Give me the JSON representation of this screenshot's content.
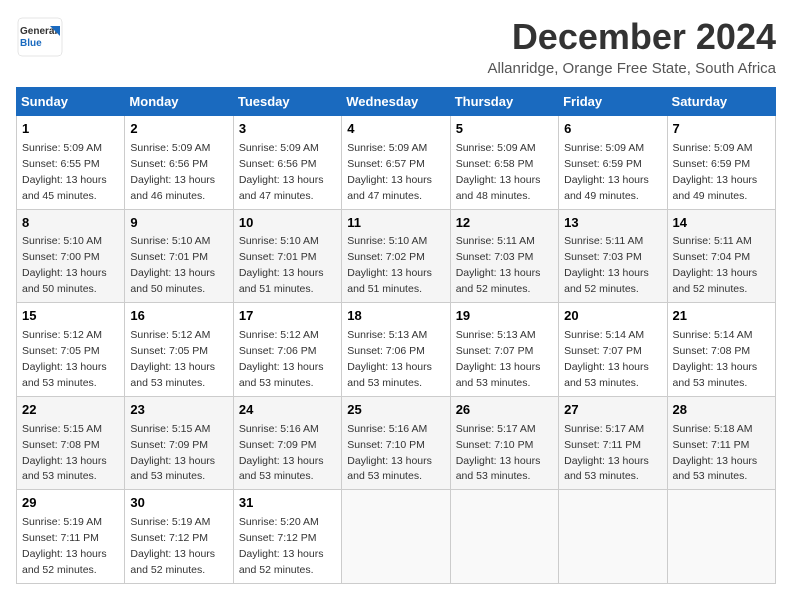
{
  "header": {
    "logo_general": "General",
    "logo_blue": "Blue",
    "month_year": "December 2024",
    "location": "Allanridge, Orange Free State, South Africa"
  },
  "weekdays": [
    "Sunday",
    "Monday",
    "Tuesday",
    "Wednesday",
    "Thursday",
    "Friday",
    "Saturday"
  ],
  "weeks": [
    [
      {
        "day": "1",
        "sunrise": "5:09 AM",
        "sunset": "6:55 PM",
        "daylight": "13 hours and 45 minutes."
      },
      {
        "day": "2",
        "sunrise": "5:09 AM",
        "sunset": "6:56 PM",
        "daylight": "13 hours and 46 minutes."
      },
      {
        "day": "3",
        "sunrise": "5:09 AM",
        "sunset": "6:56 PM",
        "daylight": "13 hours and 47 minutes."
      },
      {
        "day": "4",
        "sunrise": "5:09 AM",
        "sunset": "6:57 PM",
        "daylight": "13 hours and 47 minutes."
      },
      {
        "day": "5",
        "sunrise": "5:09 AM",
        "sunset": "6:58 PM",
        "daylight": "13 hours and 48 minutes."
      },
      {
        "day": "6",
        "sunrise": "5:09 AM",
        "sunset": "6:59 PM",
        "daylight": "13 hours and 49 minutes."
      },
      {
        "day": "7",
        "sunrise": "5:09 AM",
        "sunset": "6:59 PM",
        "daylight": "13 hours and 49 minutes."
      }
    ],
    [
      {
        "day": "8",
        "sunrise": "5:10 AM",
        "sunset": "7:00 PM",
        "daylight": "13 hours and 50 minutes."
      },
      {
        "day": "9",
        "sunrise": "5:10 AM",
        "sunset": "7:01 PM",
        "daylight": "13 hours and 50 minutes."
      },
      {
        "day": "10",
        "sunrise": "5:10 AM",
        "sunset": "7:01 PM",
        "daylight": "13 hours and 51 minutes."
      },
      {
        "day": "11",
        "sunrise": "5:10 AM",
        "sunset": "7:02 PM",
        "daylight": "13 hours and 51 minutes."
      },
      {
        "day": "12",
        "sunrise": "5:11 AM",
        "sunset": "7:03 PM",
        "daylight": "13 hours and 52 minutes."
      },
      {
        "day": "13",
        "sunrise": "5:11 AM",
        "sunset": "7:03 PM",
        "daylight": "13 hours and 52 minutes."
      },
      {
        "day": "14",
        "sunrise": "5:11 AM",
        "sunset": "7:04 PM",
        "daylight": "13 hours and 52 minutes."
      }
    ],
    [
      {
        "day": "15",
        "sunrise": "5:12 AM",
        "sunset": "7:05 PM",
        "daylight": "13 hours and 53 minutes."
      },
      {
        "day": "16",
        "sunrise": "5:12 AM",
        "sunset": "7:05 PM",
        "daylight": "13 hours and 53 minutes."
      },
      {
        "day": "17",
        "sunrise": "5:12 AM",
        "sunset": "7:06 PM",
        "daylight": "13 hours and 53 minutes."
      },
      {
        "day": "18",
        "sunrise": "5:13 AM",
        "sunset": "7:06 PM",
        "daylight": "13 hours and 53 minutes."
      },
      {
        "day": "19",
        "sunrise": "5:13 AM",
        "sunset": "7:07 PM",
        "daylight": "13 hours and 53 minutes."
      },
      {
        "day": "20",
        "sunrise": "5:14 AM",
        "sunset": "7:07 PM",
        "daylight": "13 hours and 53 minutes."
      },
      {
        "day": "21",
        "sunrise": "5:14 AM",
        "sunset": "7:08 PM",
        "daylight": "13 hours and 53 minutes."
      }
    ],
    [
      {
        "day": "22",
        "sunrise": "5:15 AM",
        "sunset": "7:08 PM",
        "daylight": "13 hours and 53 minutes."
      },
      {
        "day": "23",
        "sunrise": "5:15 AM",
        "sunset": "7:09 PM",
        "daylight": "13 hours and 53 minutes."
      },
      {
        "day": "24",
        "sunrise": "5:16 AM",
        "sunset": "7:09 PM",
        "daylight": "13 hours and 53 minutes."
      },
      {
        "day": "25",
        "sunrise": "5:16 AM",
        "sunset": "7:10 PM",
        "daylight": "13 hours and 53 minutes."
      },
      {
        "day": "26",
        "sunrise": "5:17 AM",
        "sunset": "7:10 PM",
        "daylight": "13 hours and 53 minutes."
      },
      {
        "day": "27",
        "sunrise": "5:17 AM",
        "sunset": "7:11 PM",
        "daylight": "13 hours and 53 minutes."
      },
      {
        "day": "28",
        "sunrise": "5:18 AM",
        "sunset": "7:11 PM",
        "daylight": "13 hours and 53 minutes."
      }
    ],
    [
      {
        "day": "29",
        "sunrise": "5:19 AM",
        "sunset": "7:11 PM",
        "daylight": "13 hours and 52 minutes."
      },
      {
        "day": "30",
        "sunrise": "5:19 AM",
        "sunset": "7:12 PM",
        "daylight": "13 hours and 52 minutes."
      },
      {
        "day": "31",
        "sunrise": "5:20 AM",
        "sunset": "7:12 PM",
        "daylight": "13 hours and 52 minutes."
      },
      null,
      null,
      null,
      null
    ]
  ],
  "labels": {
    "sunrise": "Sunrise:",
    "sunset": "Sunset:",
    "daylight": "Daylight:"
  }
}
